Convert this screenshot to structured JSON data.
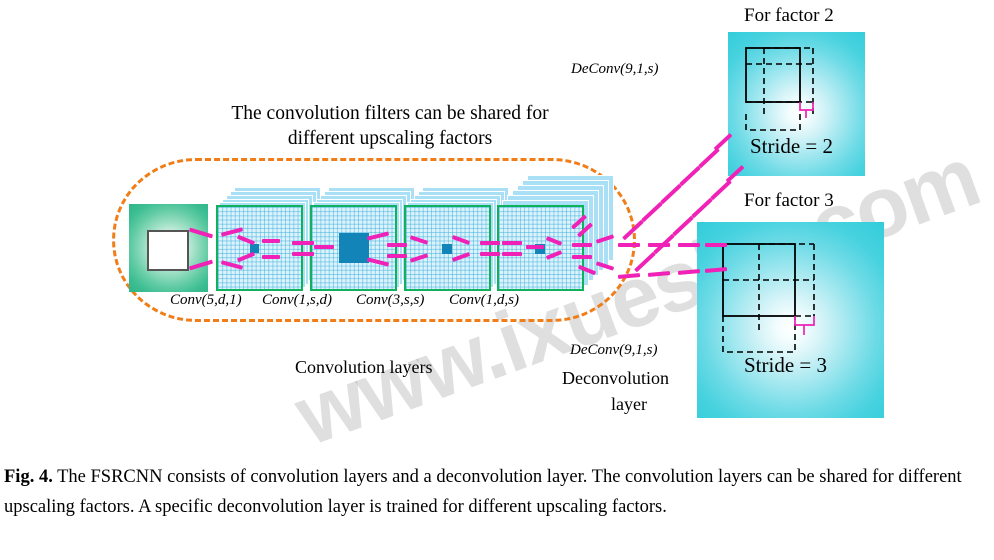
{
  "figure": {
    "title_block": "The convolution filters can be shared for\ndifferent upscaling factors",
    "conv_group_label": "Convolution layers",
    "deconv_group_label_line1": "Deconvolution",
    "deconv_group_label_line2": "layer",
    "deconv_math_top": "DeConv(9,1,s)",
    "deconv_math_bottom": "DeConv(9,1,s)",
    "conv_labels": [
      "Conv(5,d,1)",
      "Conv(1,s,d)",
      "Conv(3,s,s)",
      "Conv(1,d,s)"
    ],
    "factor_blocks": [
      {
        "heading": "For factor 2",
        "stride_label": "Stride = 2",
        "stride_value": 2
      },
      {
        "heading": "For factor 3",
        "stride_label": "Stride = 3",
        "stride_value": 3
      }
    ]
  },
  "caption": {
    "figure_number": "Fig. 4.",
    "text": " The FSRCNN consists of convolution layers and a deconvolution layer. The convolution layers can be shared for different upscaling factors. A specific deconvolution layer is trained for different upscaling factors."
  },
  "watermark": {
    "text": "www.ixueshu.com"
  },
  "colors": {
    "capsule_dashed": "#f07d18",
    "arrow_pink": "#ef21b6",
    "feature_map_border": "#10b15c",
    "feature_map_fill": "#ddf3fc",
    "sheet_fill": "#a9e0f6",
    "blue_square": "#1284b8",
    "input_gradient": "#2db689",
    "factor_gradient": "#33ccda",
    "text": "#000000"
  }
}
